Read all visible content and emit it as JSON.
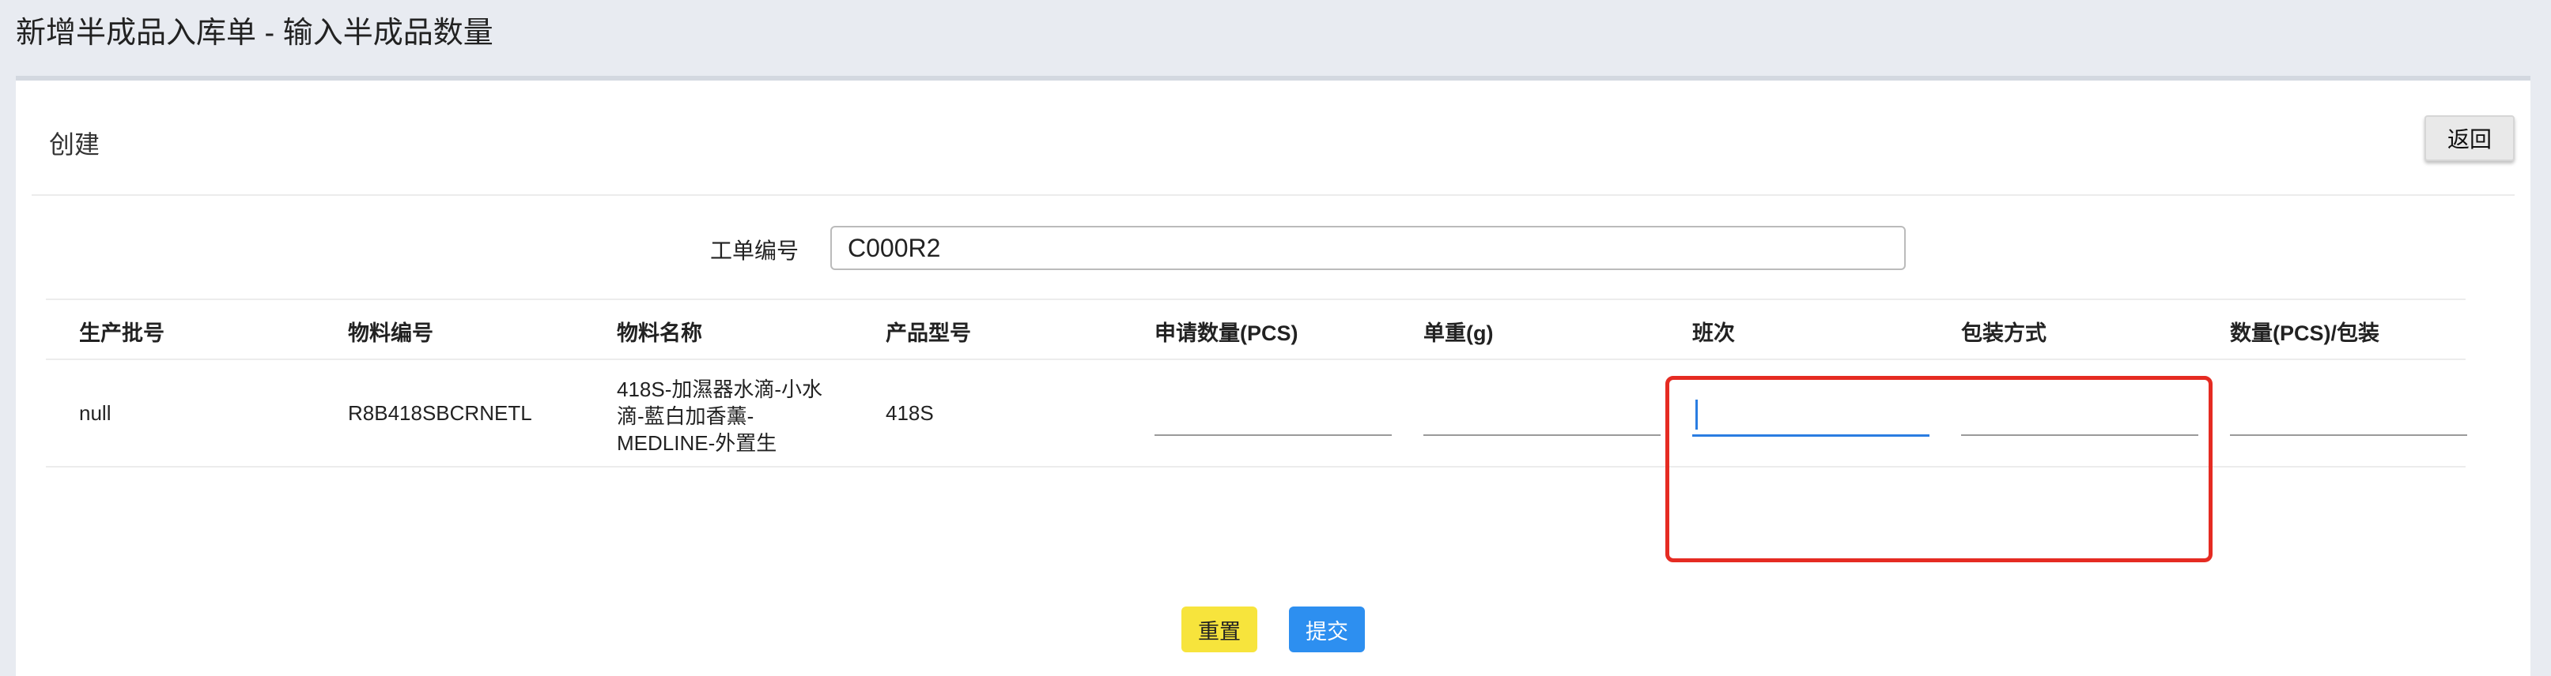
{
  "page": {
    "title": "新增半成品入库单 - 输入半成品数量"
  },
  "card": {
    "title": "创建",
    "back_label": "返回"
  },
  "form": {
    "work_order_label": "工单编号",
    "work_order_value": "C000R2"
  },
  "table": {
    "headers": [
      "生产批号",
      "物料编号",
      "物料名称",
      "产品型号",
      "申请数量(PCS)",
      "单重(g)",
      "班次",
      "包装方式",
      "数量(PCS)/包装"
    ],
    "rows": [
      {
        "batch_no": "null",
        "material_no": "R8B418SBCRNETL",
        "material_name": "418S-加濕器水滴-小水滴-藍白加香薰-MEDLINE-外置生",
        "model": "418S",
        "request_qty": "",
        "unit_weight": "",
        "shift": "",
        "packing": "",
        "qty_per_pack": ""
      }
    ]
  },
  "actions": {
    "reset_label": "重置",
    "submit_label": "提交"
  },
  "colors": {
    "accent": "#2d8ff0",
    "reset": "#f7e43c",
    "highlight": "#e52b22",
    "background": "#e8ebf1"
  }
}
